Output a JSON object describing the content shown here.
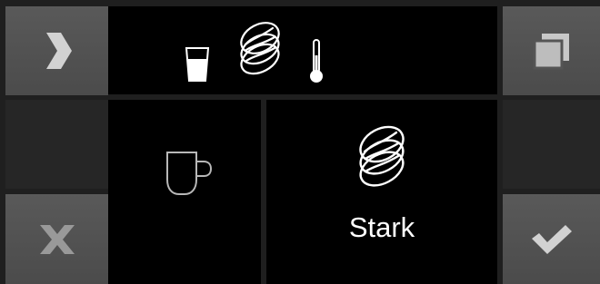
{
  "status_bar": {
    "icons": [
      "water-glass-icon",
      "coffee-beans-icon",
      "thermometer-icon"
    ]
  },
  "left_panel": {
    "icon": "coffee-cup-icon"
  },
  "right_panel": {
    "icon": "coffee-beans-icon",
    "strength_label": "Stark"
  },
  "buttons": {
    "next": "chevron-right-icon",
    "copy": "copy-icon",
    "cancel": "close-icon",
    "confirm": "checkmark-icon"
  },
  "colors": {
    "button_face": "#555555",
    "screen_bg": "#000000",
    "frame": "#1f1f1f",
    "icon_white": "#ffffff"
  }
}
